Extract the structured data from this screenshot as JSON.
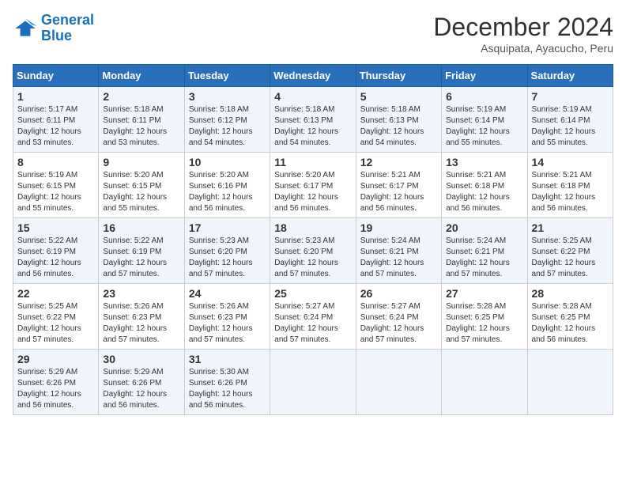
{
  "header": {
    "logo_line1": "General",
    "logo_line2": "Blue",
    "month": "December 2024",
    "location": "Asquipata, Ayacucho, Peru"
  },
  "weekdays": [
    "Sunday",
    "Monday",
    "Tuesday",
    "Wednesday",
    "Thursday",
    "Friday",
    "Saturday"
  ],
  "weeks": [
    [
      {
        "day": 1,
        "sunrise": "5:17 AM",
        "sunset": "6:11 PM",
        "daylight": "12 hours and 53 minutes."
      },
      {
        "day": 2,
        "sunrise": "5:18 AM",
        "sunset": "6:11 PM",
        "daylight": "12 hours and 53 minutes."
      },
      {
        "day": 3,
        "sunrise": "5:18 AM",
        "sunset": "6:12 PM",
        "daylight": "12 hours and 54 minutes."
      },
      {
        "day": 4,
        "sunrise": "5:18 AM",
        "sunset": "6:13 PM",
        "daylight": "12 hours and 54 minutes."
      },
      {
        "day": 5,
        "sunrise": "5:18 AM",
        "sunset": "6:13 PM",
        "daylight": "12 hours and 54 minutes."
      },
      {
        "day": 6,
        "sunrise": "5:19 AM",
        "sunset": "6:14 PM",
        "daylight": "12 hours and 55 minutes."
      },
      {
        "day": 7,
        "sunrise": "5:19 AM",
        "sunset": "6:14 PM",
        "daylight": "12 hours and 55 minutes."
      }
    ],
    [
      {
        "day": 8,
        "sunrise": "5:19 AM",
        "sunset": "6:15 PM",
        "daylight": "12 hours and 55 minutes."
      },
      {
        "day": 9,
        "sunrise": "5:20 AM",
        "sunset": "6:15 PM",
        "daylight": "12 hours and 55 minutes."
      },
      {
        "day": 10,
        "sunrise": "5:20 AM",
        "sunset": "6:16 PM",
        "daylight": "12 hours and 56 minutes."
      },
      {
        "day": 11,
        "sunrise": "5:20 AM",
        "sunset": "6:17 PM",
        "daylight": "12 hours and 56 minutes."
      },
      {
        "day": 12,
        "sunrise": "5:21 AM",
        "sunset": "6:17 PM",
        "daylight": "12 hours and 56 minutes."
      },
      {
        "day": 13,
        "sunrise": "5:21 AM",
        "sunset": "6:18 PM",
        "daylight": "12 hours and 56 minutes."
      },
      {
        "day": 14,
        "sunrise": "5:21 AM",
        "sunset": "6:18 PM",
        "daylight": "12 hours and 56 minutes."
      }
    ],
    [
      {
        "day": 15,
        "sunrise": "5:22 AM",
        "sunset": "6:19 PM",
        "daylight": "12 hours and 56 minutes."
      },
      {
        "day": 16,
        "sunrise": "5:22 AM",
        "sunset": "6:19 PM",
        "daylight": "12 hours and 57 minutes."
      },
      {
        "day": 17,
        "sunrise": "5:23 AM",
        "sunset": "6:20 PM",
        "daylight": "12 hours and 57 minutes."
      },
      {
        "day": 18,
        "sunrise": "5:23 AM",
        "sunset": "6:20 PM",
        "daylight": "12 hours and 57 minutes."
      },
      {
        "day": 19,
        "sunrise": "5:24 AM",
        "sunset": "6:21 PM",
        "daylight": "12 hours and 57 minutes."
      },
      {
        "day": 20,
        "sunrise": "5:24 AM",
        "sunset": "6:21 PM",
        "daylight": "12 hours and 57 minutes."
      },
      {
        "day": 21,
        "sunrise": "5:25 AM",
        "sunset": "6:22 PM",
        "daylight": "12 hours and 57 minutes."
      }
    ],
    [
      {
        "day": 22,
        "sunrise": "5:25 AM",
        "sunset": "6:22 PM",
        "daylight": "12 hours and 57 minutes."
      },
      {
        "day": 23,
        "sunrise": "5:26 AM",
        "sunset": "6:23 PM",
        "daylight": "12 hours and 57 minutes."
      },
      {
        "day": 24,
        "sunrise": "5:26 AM",
        "sunset": "6:23 PM",
        "daylight": "12 hours and 57 minutes."
      },
      {
        "day": 25,
        "sunrise": "5:27 AM",
        "sunset": "6:24 PM",
        "daylight": "12 hours and 57 minutes."
      },
      {
        "day": 26,
        "sunrise": "5:27 AM",
        "sunset": "6:24 PM",
        "daylight": "12 hours and 57 minutes."
      },
      {
        "day": 27,
        "sunrise": "5:28 AM",
        "sunset": "6:25 PM",
        "daylight": "12 hours and 57 minutes."
      },
      {
        "day": 28,
        "sunrise": "5:28 AM",
        "sunset": "6:25 PM",
        "daylight": "12 hours and 56 minutes."
      }
    ],
    [
      {
        "day": 29,
        "sunrise": "5:29 AM",
        "sunset": "6:26 PM",
        "daylight": "12 hours and 56 minutes."
      },
      {
        "day": 30,
        "sunrise": "5:29 AM",
        "sunset": "6:26 PM",
        "daylight": "12 hours and 56 minutes."
      },
      {
        "day": 31,
        "sunrise": "5:30 AM",
        "sunset": "6:26 PM",
        "daylight": "12 hours and 56 minutes."
      },
      null,
      null,
      null,
      null
    ]
  ]
}
